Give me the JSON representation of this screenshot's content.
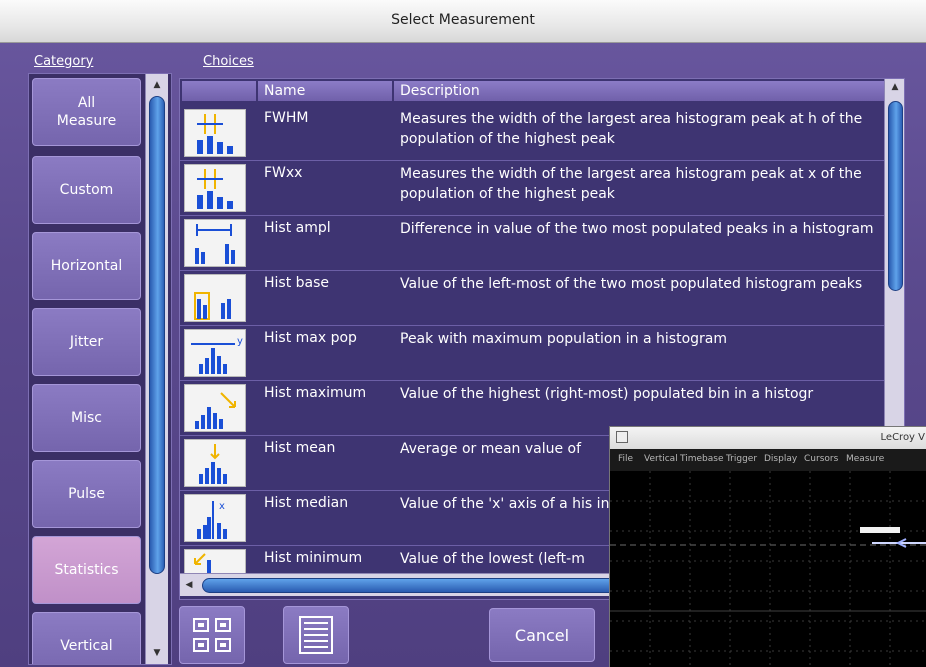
{
  "window": {
    "title": "Select Measurement"
  },
  "sections": {
    "category_label": "Category",
    "choices_label": "Choices"
  },
  "categories": [
    {
      "label": "All Measure"
    },
    {
      "label": "Custom"
    },
    {
      "label": "Horizontal"
    },
    {
      "label": "Jitter"
    },
    {
      "label": "Misc"
    },
    {
      "label": "Pulse"
    },
    {
      "label": "Statistics"
    },
    {
      "label": "Vertical"
    }
  ],
  "table": {
    "columns": {
      "icon": "",
      "name": "Name",
      "description": "Description"
    },
    "rows": [
      {
        "name": "FWHM",
        "description": "Measures the width of the largest area histogram peak at h of the population of the highest peak",
        "icon": "fwhm-icon"
      },
      {
        "name": "FWxx",
        "description": "Measures the width of the largest area histogram peak at x of the population of the highest peak",
        "icon": "fwxx-icon"
      },
      {
        "name": "Hist ampl",
        "description": "Difference in value of the two most populated peaks in a histogram",
        "icon": "hist-ampl-icon"
      },
      {
        "name": "Hist base",
        "description": "Value of the left-most of the two most populated histogram peaks",
        "icon": "hist-base-icon"
      },
      {
        "name": "Hist max pop",
        "description": "Peak with maximum population in a histogram",
        "icon": "hist-max-pop-icon"
      },
      {
        "name": "Hist maximum",
        "description": "Value of the highest (right-most) populated bin in a histogr",
        "icon": "hist-maximum-icon"
      },
      {
        "name": "Hist mean",
        "description": "Average or mean value of",
        "icon": "hist-mean-icon"
      },
      {
        "name": "Hist median",
        "description": "Value of the 'x' axis of a his into two equal halves",
        "icon": "hist-median-icon"
      },
      {
        "name": "Hist minimum",
        "description": "Value of the lowest (left-m",
        "icon": "hist-minimum-icon"
      }
    ]
  },
  "buttons": {
    "cancel": "Cancel"
  },
  "scope": {
    "title_text": "LeCroy V",
    "menu": [
      "File",
      "Vertical",
      "Timebase",
      "Trigger",
      "Display",
      "Cursors",
      "Measure"
    ]
  }
}
